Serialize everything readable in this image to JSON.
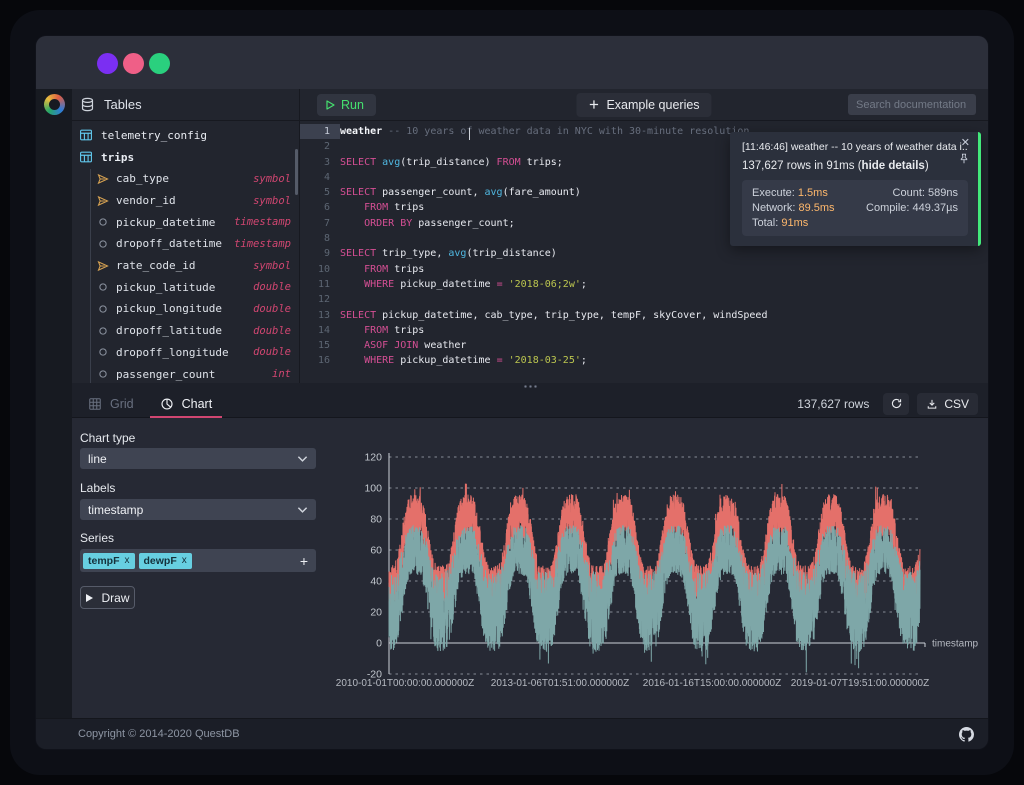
{
  "window": {
    "traffic_lights": [
      "#7b2ff2",
      "#ef5f87",
      "#2ad07e"
    ]
  },
  "toolbar": {
    "tables_label": "Tables",
    "run_label": "Run",
    "example_queries_label": "Example queries",
    "search_placeholder": "Search documentation"
  },
  "sidebar": {
    "tables": [
      {
        "name": "telemetry_config",
        "columns": []
      },
      {
        "name": "trips",
        "columns": [
          {
            "name": "cab_type",
            "type": "symbol",
            "kind": "symbol"
          },
          {
            "name": "vendor_id",
            "type": "symbol",
            "kind": "symbol"
          },
          {
            "name": "pickup_datetime",
            "type": "timestamp",
            "kind": "plain"
          },
          {
            "name": "dropoff_datetime",
            "type": "timestamp",
            "kind": "plain"
          },
          {
            "name": "rate_code_id",
            "type": "symbol",
            "kind": "symbol"
          },
          {
            "name": "pickup_latitude",
            "type": "double",
            "kind": "plain"
          },
          {
            "name": "pickup_longitude",
            "type": "double",
            "kind": "plain"
          },
          {
            "name": "dropoff_latitude",
            "type": "double",
            "kind": "plain"
          },
          {
            "name": "dropoff_longitude",
            "type": "double",
            "kind": "plain"
          },
          {
            "name": "passenger_count",
            "type": "int",
            "kind": "plain"
          }
        ]
      }
    ]
  },
  "editor": {
    "lines": [
      {
        "n": 1,
        "active": true,
        "segs": [
          [
            "b",
            "weather "
          ],
          [
            "com",
            "-- 10 years of weather data in NYC with 30-minute resolution"
          ]
        ]
      },
      {
        "n": 2,
        "segs": []
      },
      {
        "n": 3,
        "segs": [
          [
            "kw",
            "SELECT"
          ],
          [
            "txt",
            " "
          ],
          [
            "fn",
            "avg"
          ],
          [
            "txt",
            "(trip_distance) "
          ],
          [
            "kw",
            "FROM"
          ],
          [
            "txt",
            " trips;"
          ]
        ]
      },
      {
        "n": 4,
        "segs": []
      },
      {
        "n": 5,
        "segs": [
          [
            "kw",
            "SELECT"
          ],
          [
            "txt",
            " passenger_count, "
          ],
          [
            "fn",
            "avg"
          ],
          [
            "txt",
            "(fare_amount)"
          ]
        ]
      },
      {
        "n": 6,
        "segs": [
          [
            "txt",
            "    "
          ],
          [
            "kw",
            "FROM"
          ],
          [
            "txt",
            " trips"
          ]
        ]
      },
      {
        "n": 7,
        "segs": [
          [
            "txt",
            "    "
          ],
          [
            "kw",
            "ORDER BY"
          ],
          [
            "txt",
            " passenger_count;"
          ]
        ]
      },
      {
        "n": 8,
        "segs": []
      },
      {
        "n": 9,
        "segs": [
          [
            "kw",
            "SELECT"
          ],
          [
            "txt",
            " trip_type, "
          ],
          [
            "fn",
            "avg"
          ],
          [
            "txt",
            "(trip_distance)"
          ]
        ]
      },
      {
        "n": 10,
        "segs": [
          [
            "txt",
            "    "
          ],
          [
            "kw",
            "FROM"
          ],
          [
            "txt",
            " trips"
          ]
        ]
      },
      {
        "n": 11,
        "segs": [
          [
            "txt",
            "    "
          ],
          [
            "kw",
            "WHERE"
          ],
          [
            "txt",
            " pickup_datetime "
          ],
          [
            "op",
            "="
          ],
          [
            "txt",
            " "
          ],
          [
            "str",
            "'2018-06;2w'"
          ],
          [
            "txt",
            ";"
          ]
        ]
      },
      {
        "n": 12,
        "segs": []
      },
      {
        "n": 13,
        "segs": [
          [
            "kw",
            "SELECT"
          ],
          [
            "txt",
            " pickup_datetime, cab_type, trip_type, tempF, skyCover, windSpeed"
          ]
        ]
      },
      {
        "n": 14,
        "segs": [
          [
            "txt",
            "    "
          ],
          [
            "kw",
            "FROM"
          ],
          [
            "txt",
            " trips"
          ]
        ]
      },
      {
        "n": 15,
        "segs": [
          [
            "txt",
            "    "
          ],
          [
            "kw",
            "ASOF JOIN"
          ],
          [
            "txt",
            " weather"
          ]
        ]
      },
      {
        "n": 16,
        "segs": [
          [
            "txt",
            "    "
          ],
          [
            "kw",
            "WHERE"
          ],
          [
            "txt",
            " pickup_datetime "
          ],
          [
            "op",
            "="
          ],
          [
            "txt",
            " "
          ],
          [
            "str",
            "'2018-03-25'"
          ],
          [
            "txt",
            ";"
          ]
        ]
      }
    ]
  },
  "notification": {
    "title": "[11:46:46] weather -- 10 years of weather data i...",
    "summary_prefix": "137,627 rows in 91ms (",
    "summary_link": "hide details",
    "summary_suffix": ")",
    "metrics": {
      "execute_label": "Execute:",
      "execute_value": "1.5ms",
      "network_label": "Network:",
      "network_value": "89.5ms",
      "total_label": "Total:",
      "total_value": "91ms",
      "count_label": "Count:",
      "count_value": "589ns",
      "compile_label": "Compile:",
      "compile_value": "449.37µs"
    },
    "accent": "#43e97b"
  },
  "results": {
    "tabs": [
      {
        "label": "Grid"
      },
      {
        "label": "Chart"
      }
    ],
    "active_tab": "Chart",
    "rows_count": "137,627 rows",
    "csv_label": "CSV"
  },
  "chart_controls": {
    "chart_type_label": "Chart type",
    "chart_type_value": "line",
    "labels_label": "Labels",
    "labels_value": "timestamp",
    "series_label": "Series",
    "series_tags": [
      {
        "name": "tempF",
        "remove": "x"
      },
      {
        "name": "dewpF",
        "remove": "x"
      }
    ],
    "add_series_label": "+",
    "draw_label": "Draw"
  },
  "chart_data": {
    "type": "line",
    "xlabel": "timestamp",
    "x_tick_labels": [
      "2010-01-01T00:00:00.000000Z",
      "2013-01-06T01:51:00.000000Z",
      "2016-01-16T15:00:00.000000Z",
      "2019-01-07T19:51:00.000000Z"
    ],
    "y_ticks": [
      120,
      100,
      80,
      60,
      40,
      20,
      0,
      -20
    ],
    "ylim": [
      -20,
      120
    ],
    "grid": "dashed-horizontal",
    "legend": false,
    "cycles": 10.2,
    "points_per_series": 5200,
    "series": [
      {
        "name": "tempF",
        "color": "#e4706a",
        "winter_mean": 36,
        "summer_mean": 82,
        "noise_summer": 14,
        "noise_winter": 14,
        "min": 23,
        "max": 103,
        "seed": 42
      },
      {
        "name": "dewpF",
        "color": "#7ea7a8",
        "winter_mean": 20,
        "summer_mean": 60,
        "noise_summer": 16,
        "noise_winter": 26,
        "min": -19,
        "max": 77,
        "seed": 1337
      }
    ]
  },
  "footer": {
    "copyright": "Copyright © 2014-2020 QuestDB"
  }
}
